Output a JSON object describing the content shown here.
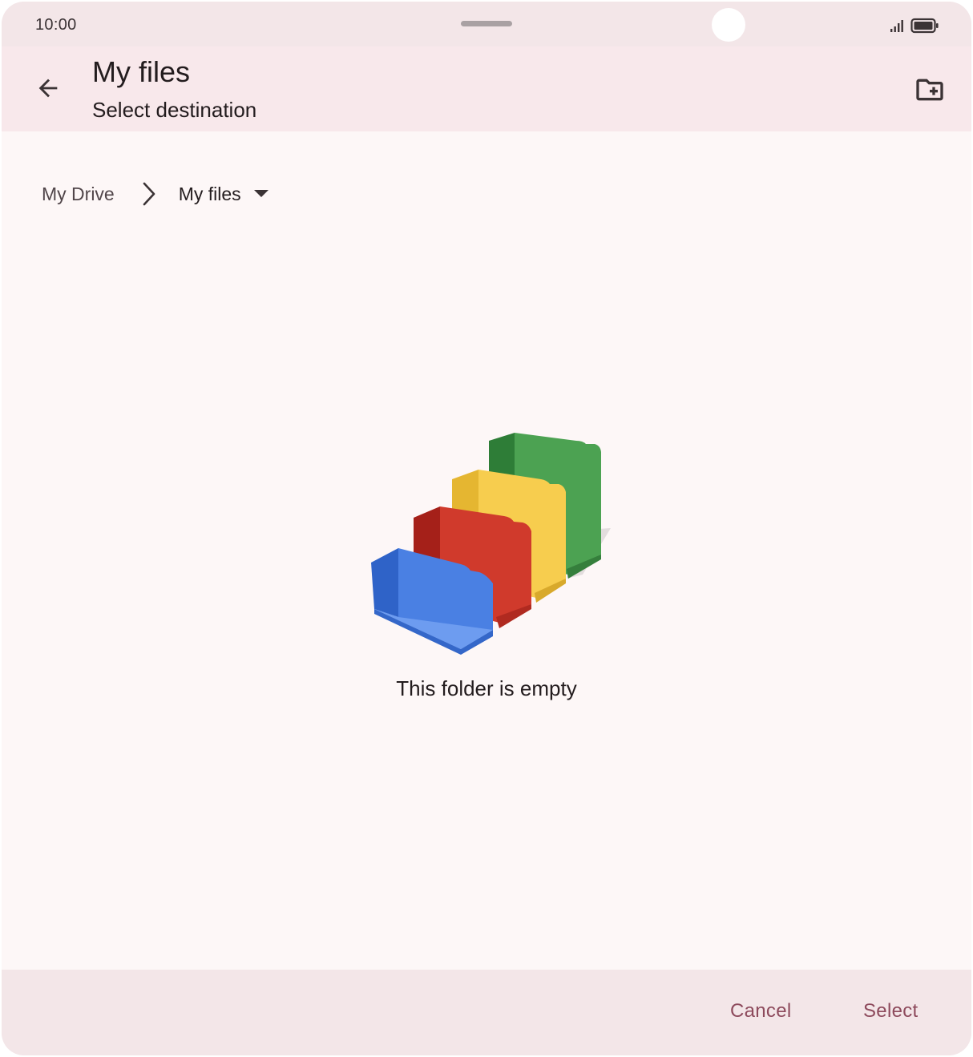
{
  "status_bar": {
    "time": "10:00",
    "signal_icon": "signal-icon",
    "battery_icon": "battery-icon"
  },
  "app_bar": {
    "title": "My files",
    "subtitle": "Select destination",
    "back_icon": "arrow-back-icon",
    "new_folder_icon": "create-new-folder-icon"
  },
  "breadcrumb": {
    "root_label": "My Drive",
    "separator_icon": "chevron-right-icon",
    "current_label": "My files",
    "dropdown_icon": "arrow-drop-down-icon"
  },
  "empty_state": {
    "illustration": "empty-folder-illustration",
    "message": "This folder is empty"
  },
  "actions": {
    "cancel_label": "Cancel",
    "select_label": "Select"
  },
  "colors": {
    "background": "#fdf7f7",
    "app_bar": "#f8e8eb",
    "status_bar": "#f3e6e8",
    "bottom_bar": "#f3e6e8",
    "accent_text": "#8d4a5c",
    "primary_text": "#231c1e",
    "folder_green": "#4ca252",
    "folder_yellow": "#f7cd4e",
    "folder_red": "#d03a2c",
    "folder_blue": "#4a80e3"
  }
}
